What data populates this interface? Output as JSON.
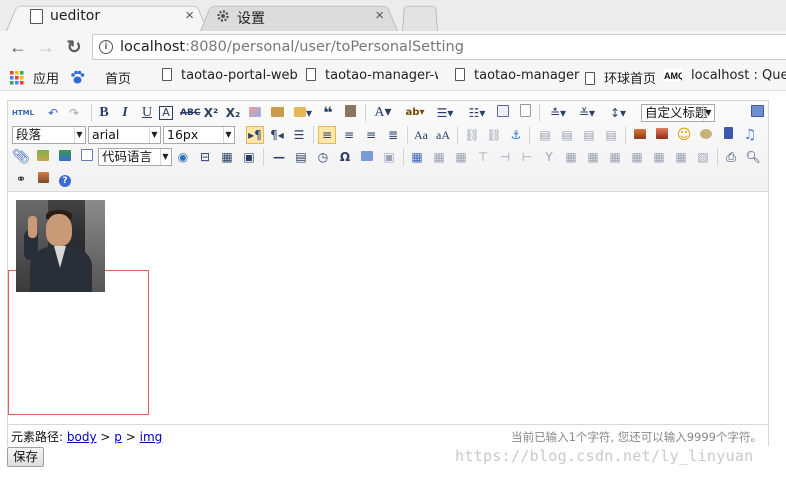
{
  "browser": {
    "tabs": [
      {
        "title": "ueditor",
        "close": "×",
        "icon": "page-icon",
        "active": true
      },
      {
        "title": "设置",
        "close": "×",
        "icon": "gear-icon",
        "active": false
      }
    ],
    "nav": {
      "back": "←",
      "forward": "→",
      "reload": "↻"
    },
    "url_host": "localhost",
    "url_rest": ":8080/personal/user/toPersonalSetting"
  },
  "bookmarks": [
    {
      "label": "应用",
      "icon": "apps-grid-icon"
    },
    {
      "label": "首页",
      "icon": "paw-icon"
    },
    {
      "label": "taotao-portal-web",
      "icon": "page-icon"
    },
    {
      "label": "taotao-manager-we",
      "icon": "page-icon"
    },
    {
      "label": "taotao-manager",
      "icon": "page-icon"
    },
    {
      "label": "环球首页",
      "icon": "page-icon"
    },
    {
      "label": "localhost : Queue",
      "icon": "amq-icon"
    }
  ],
  "editor": {
    "toolbar": {
      "html_label": "HTML",
      "paragraph": "段落",
      "font_family": "arial",
      "font_size": "16px",
      "custom_title": "自定义标题",
      "code_language": "代码语言"
    },
    "status": {
      "path_label": "元素路径:",
      "path": [
        "body",
        "p",
        "img"
      ],
      "path_sep": ">",
      "count_text": "当前已输入1个字符, 您还可以输入9999个字符。"
    }
  },
  "save_label": "保存",
  "watermark": "https://blog.csdn.net/ly_linyuan",
  "colors": {
    "selection_border": "#e55b5b",
    "link": "#0000cc",
    "toolbar_icon": "#2b3e66"
  }
}
